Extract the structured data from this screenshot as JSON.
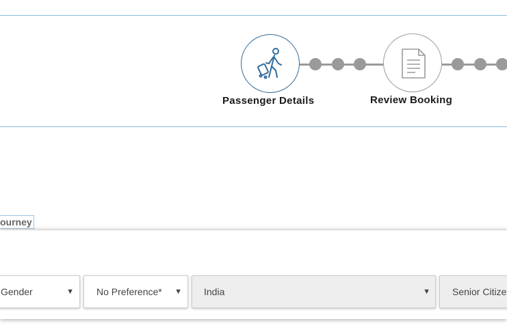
{
  "steps": [
    {
      "label": "Passenger Details",
      "icon": "traveler-icon",
      "state": "active"
    },
    {
      "label": "Review Booking",
      "icon": "document-icon",
      "state": "inactive"
    }
  ],
  "journey_tag": "ourney",
  "passenger_row": {
    "gender": "Gender",
    "berth_preference": "No Preference*",
    "country": "India",
    "senior_citizen": "Senior Citizen"
  },
  "colors": {
    "accent": "#2e6a9b",
    "divider": "#8cbadb",
    "inactive": "#9a9a9a",
    "disabled_field_bg": "#eeeeee"
  }
}
